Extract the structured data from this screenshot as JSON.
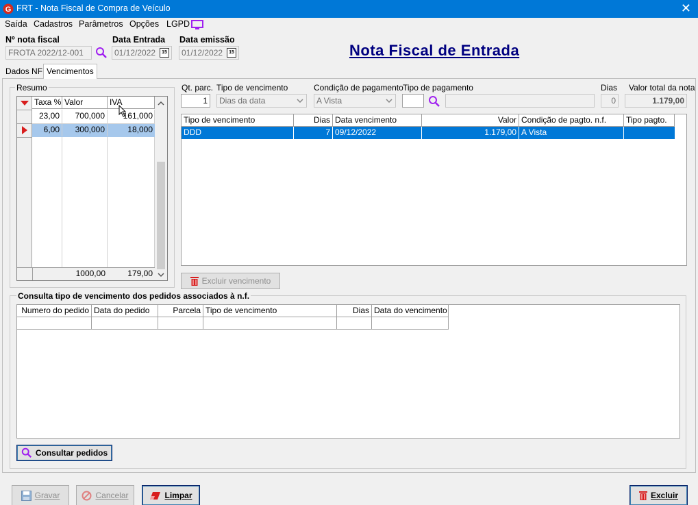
{
  "window": {
    "title": "FRT - Nota Fiscal de Compra de Veículo",
    "close": "✕"
  },
  "menu": [
    "Saída",
    "Cadastros",
    "Parâmetros",
    "Opções",
    "LGPD"
  ],
  "header": {
    "nota_label": "Nº nota fiscal",
    "nota_value": "FROTA 2022/12-001",
    "entrada_label": "Data Entrada",
    "entrada_value": "01/12/2022",
    "emissao_label": "Data emissão",
    "emissao_value": "01/12/2022",
    "calendar_text": "15",
    "big_title": "Nota Fiscal de Entrada"
  },
  "tabs": [
    {
      "label": "Dados NF",
      "active": false
    },
    {
      "label": "Vencimentos",
      "active": true
    }
  ],
  "resumo": {
    "title": "Resumo",
    "columns": [
      "Taxa %",
      "Valor",
      "IVA"
    ],
    "rows": [
      {
        "taxa": "23,00",
        "valor": "700,000",
        "iva": "161,000"
      },
      {
        "taxa": "6,00",
        "valor": "300,000",
        "iva": "18,000"
      }
    ],
    "total_valor": "1000,00",
    "total_iva": "179,00"
  },
  "vencimento_form": {
    "qt_label": "Qt. parc.",
    "qt_value": "1",
    "tipo_label": "Tipo de vencimento",
    "tipo_value": "Dias da data",
    "cond_label": "Condição de pagamento",
    "cond_value": "A Vista",
    "tipopag_label": "Tipo de pagamento",
    "tipopag_value": "",
    "tipopag_desc": "",
    "dias_label": "Dias",
    "dias_value": "0",
    "total_label": "Valor total da nota",
    "total_value": "1.179,00"
  },
  "venc_grid": {
    "columns": [
      "Tipo de vencimento",
      "Dias",
      "Data vencimento",
      "Valor",
      "Condição de pagto. n.f.",
      "Tipo pagto."
    ],
    "rows": [
      {
        "tipo": "DDD",
        "dias": "7",
        "data": "09/12/2022",
        "valor": "1.179,00",
        "cond": "A Vista",
        "tipo_pagto": ""
      }
    ]
  },
  "excluir_venc": "Excluir vencimento",
  "consulta": {
    "title": "Consulta tipo de vencimento dos pedidos associados à n.f.",
    "columns": [
      "Numero do pedido",
      "Data do pedido",
      "Parcela",
      "Tipo de vencimento",
      "Dias",
      "Data do vencimento"
    ],
    "button": "Consultar pedidos"
  },
  "footer": {
    "gravar": "Gravar",
    "cancelar": "Cancelar",
    "limpar": "Limpar",
    "excluir": "Excluir"
  },
  "colors": {
    "titlebar": "#0078d7",
    "title_text": "#000080",
    "selection": "#0078d7",
    "accent_icon": "#a020f0",
    "delete_red": "#d81e1e"
  }
}
